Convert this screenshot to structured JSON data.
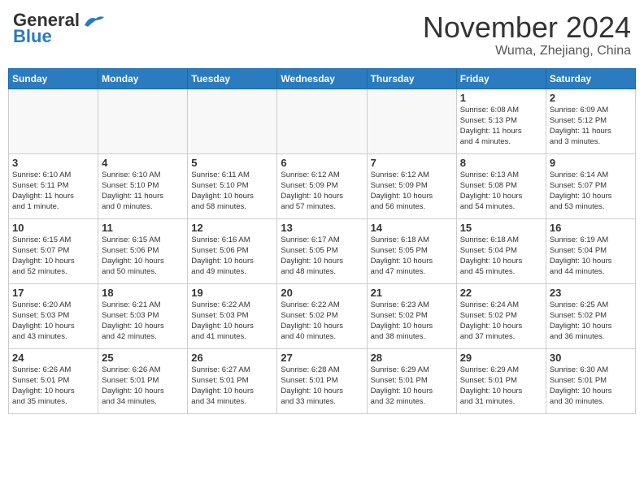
{
  "header": {
    "logo_line1": "General",
    "logo_line2": "Blue",
    "month": "November 2024",
    "location": "Wuma, Zhejiang, China"
  },
  "weekdays": [
    "Sunday",
    "Monday",
    "Tuesday",
    "Wednesday",
    "Thursday",
    "Friday",
    "Saturday"
  ],
  "weeks": [
    [
      {
        "day": "",
        "info": ""
      },
      {
        "day": "",
        "info": ""
      },
      {
        "day": "",
        "info": ""
      },
      {
        "day": "",
        "info": ""
      },
      {
        "day": "",
        "info": ""
      },
      {
        "day": "1",
        "info": "Sunrise: 6:08 AM\nSunset: 5:13 PM\nDaylight: 11 hours\nand 4 minutes."
      },
      {
        "day": "2",
        "info": "Sunrise: 6:09 AM\nSunset: 5:12 PM\nDaylight: 11 hours\nand 3 minutes."
      }
    ],
    [
      {
        "day": "3",
        "info": "Sunrise: 6:10 AM\nSunset: 5:11 PM\nDaylight: 11 hours\nand 1 minute."
      },
      {
        "day": "4",
        "info": "Sunrise: 6:10 AM\nSunset: 5:10 PM\nDaylight: 11 hours\nand 0 minutes."
      },
      {
        "day": "5",
        "info": "Sunrise: 6:11 AM\nSunset: 5:10 PM\nDaylight: 10 hours\nand 58 minutes."
      },
      {
        "day": "6",
        "info": "Sunrise: 6:12 AM\nSunset: 5:09 PM\nDaylight: 10 hours\nand 57 minutes."
      },
      {
        "day": "7",
        "info": "Sunrise: 6:12 AM\nSunset: 5:09 PM\nDaylight: 10 hours\nand 56 minutes."
      },
      {
        "day": "8",
        "info": "Sunrise: 6:13 AM\nSunset: 5:08 PM\nDaylight: 10 hours\nand 54 minutes."
      },
      {
        "day": "9",
        "info": "Sunrise: 6:14 AM\nSunset: 5:07 PM\nDaylight: 10 hours\nand 53 minutes."
      }
    ],
    [
      {
        "day": "10",
        "info": "Sunrise: 6:15 AM\nSunset: 5:07 PM\nDaylight: 10 hours\nand 52 minutes."
      },
      {
        "day": "11",
        "info": "Sunrise: 6:15 AM\nSunset: 5:06 PM\nDaylight: 10 hours\nand 50 minutes."
      },
      {
        "day": "12",
        "info": "Sunrise: 6:16 AM\nSunset: 5:06 PM\nDaylight: 10 hours\nand 49 minutes."
      },
      {
        "day": "13",
        "info": "Sunrise: 6:17 AM\nSunset: 5:05 PM\nDaylight: 10 hours\nand 48 minutes."
      },
      {
        "day": "14",
        "info": "Sunrise: 6:18 AM\nSunset: 5:05 PM\nDaylight: 10 hours\nand 47 minutes."
      },
      {
        "day": "15",
        "info": "Sunrise: 6:18 AM\nSunset: 5:04 PM\nDaylight: 10 hours\nand 45 minutes."
      },
      {
        "day": "16",
        "info": "Sunrise: 6:19 AM\nSunset: 5:04 PM\nDaylight: 10 hours\nand 44 minutes."
      }
    ],
    [
      {
        "day": "17",
        "info": "Sunrise: 6:20 AM\nSunset: 5:03 PM\nDaylight: 10 hours\nand 43 minutes."
      },
      {
        "day": "18",
        "info": "Sunrise: 6:21 AM\nSunset: 5:03 PM\nDaylight: 10 hours\nand 42 minutes."
      },
      {
        "day": "19",
        "info": "Sunrise: 6:22 AM\nSunset: 5:03 PM\nDaylight: 10 hours\nand 41 minutes."
      },
      {
        "day": "20",
        "info": "Sunrise: 6:22 AM\nSunset: 5:02 PM\nDaylight: 10 hours\nand 40 minutes."
      },
      {
        "day": "21",
        "info": "Sunrise: 6:23 AM\nSunset: 5:02 PM\nDaylight: 10 hours\nand 38 minutes."
      },
      {
        "day": "22",
        "info": "Sunrise: 6:24 AM\nSunset: 5:02 PM\nDaylight: 10 hours\nand 37 minutes."
      },
      {
        "day": "23",
        "info": "Sunrise: 6:25 AM\nSunset: 5:02 PM\nDaylight: 10 hours\nand 36 minutes."
      }
    ],
    [
      {
        "day": "24",
        "info": "Sunrise: 6:26 AM\nSunset: 5:01 PM\nDaylight: 10 hours\nand 35 minutes."
      },
      {
        "day": "25",
        "info": "Sunrise: 6:26 AM\nSunset: 5:01 PM\nDaylight: 10 hours\nand 34 minutes."
      },
      {
        "day": "26",
        "info": "Sunrise: 6:27 AM\nSunset: 5:01 PM\nDaylight: 10 hours\nand 34 minutes."
      },
      {
        "day": "27",
        "info": "Sunrise: 6:28 AM\nSunset: 5:01 PM\nDaylight: 10 hours\nand 33 minutes."
      },
      {
        "day": "28",
        "info": "Sunrise: 6:29 AM\nSunset: 5:01 PM\nDaylight: 10 hours\nand 32 minutes."
      },
      {
        "day": "29",
        "info": "Sunrise: 6:29 AM\nSunset: 5:01 PM\nDaylight: 10 hours\nand 31 minutes."
      },
      {
        "day": "30",
        "info": "Sunrise: 6:30 AM\nSunset: 5:01 PM\nDaylight: 10 hours\nand 30 minutes."
      }
    ]
  ]
}
